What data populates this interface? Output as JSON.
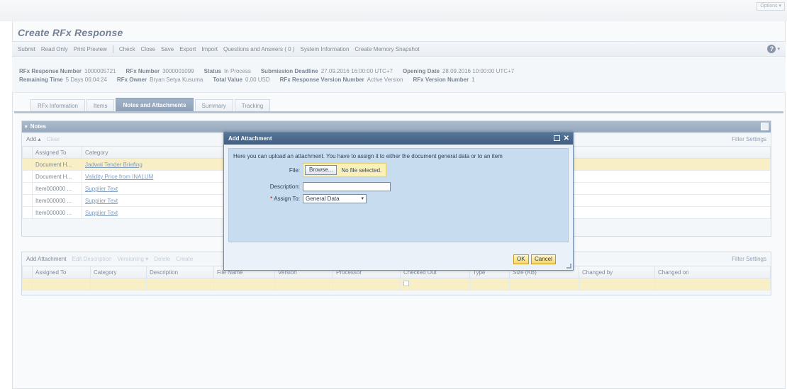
{
  "top": {
    "options_label": "Options ▾"
  },
  "page": {
    "title": "Create RFx Response"
  },
  "toolbar": {
    "group1": [
      "Submit",
      "Read Only",
      "Print Preview"
    ],
    "group2": [
      "Check",
      "Close",
      "Save",
      "Export",
      "Import",
      "Questions and Answers ( 0 )",
      "System Information",
      "Create Memory Snapshot"
    ],
    "help_label": "?",
    "help_caret": "▾"
  },
  "header": {
    "row1": [
      {
        "label": "RFx Response Number",
        "value": "1000005721"
      },
      {
        "label": "RFx Number",
        "value": "3000001099"
      },
      {
        "label": "Status",
        "value": "In Process"
      },
      {
        "label": "Submission Deadline",
        "value": "27.09.2016 16:00:00 UTC+7"
      },
      {
        "label": "Opening Date",
        "value": "28.09.2016 10:00:00 UTC+7"
      }
    ],
    "row2": [
      {
        "label": "Remaining Time",
        "value": "5 Days 06:04:24"
      },
      {
        "label": "RFx Owner",
        "value": "Bryan Setya Kusuma"
      },
      {
        "label": "Total Value",
        "value": "0,00 USD"
      },
      {
        "label": "RFx Response Version Number",
        "value": "Active Version"
      },
      {
        "label": "RFx Version Number",
        "value": "1"
      }
    ]
  },
  "tabs": [
    {
      "label": "RFx Information",
      "active": false
    },
    {
      "label": "Items",
      "active": false
    },
    {
      "label": "Notes and Attachments",
      "active": true
    },
    {
      "label": "Summary",
      "active": false
    },
    {
      "label": "Tracking",
      "active": false
    }
  ],
  "notes": {
    "title": "Notes",
    "collapse_icon": "▾",
    "add_label": "Add ▴",
    "clear_label": "Clear",
    "filter_label": "Filter Settings",
    "columns": [
      "Assigned To",
      "Category"
    ],
    "rows": [
      {
        "assigned": "Document H...",
        "category": "Jadwal Tender Briefing",
        "selected": true
      },
      {
        "assigned": "Document H...",
        "category": "Validity Price from INALUM",
        "selected": false
      },
      {
        "assigned": "Item000000 ...",
        "category": "Supplier Text",
        "selected": false
      },
      {
        "assigned": "Item000000 ...",
        "category": "Supplier Text",
        "selected": false
      },
      {
        "assigned": "Item000000 ...",
        "category": "Supplier Text",
        "selected": false
      }
    ]
  },
  "attachments": {
    "tools": [
      {
        "label": "Add Attachment",
        "disabled": false
      },
      {
        "label": "Edit Description",
        "disabled": true
      },
      {
        "label": "Versioning ▾",
        "disabled": true
      },
      {
        "label": "Delete",
        "disabled": true
      },
      {
        "label": "Create",
        "disabled": true
      }
    ],
    "filter_label": "Filter Settings",
    "columns": [
      "Assigned To",
      "Category",
      "Description",
      "File Name",
      "Version",
      "Processor",
      "Checked Out",
      "Type",
      "Size (KB)",
      "Changed by",
      "Changed on"
    ]
  },
  "dialog": {
    "title": "Add Attachment",
    "close_label": "✕",
    "intro": "Here you can upload an attachment. You have to assign it to either the document general data or to an item",
    "file_label": "File:",
    "browse_label": "Browse...",
    "no_file_label": "No file selected.",
    "description_label": "Description:",
    "description_value": "",
    "required_mark": "*",
    "assign_label": "Assign To:",
    "assign_value": "General Data",
    "assign_arrow": "▾",
    "ok_label": "OK",
    "cancel_label": "Cancel"
  }
}
